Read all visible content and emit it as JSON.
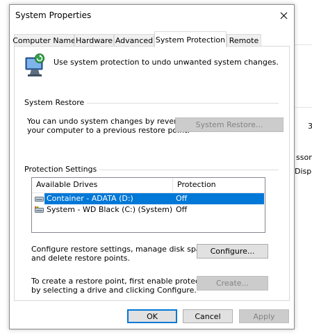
{
  "background": {
    "fragments": [
      "3",
      "ssor",
      "Displ"
    ]
  },
  "dialog": {
    "title": "System Properties",
    "tabs": [
      {
        "label": "Computer Name"
      },
      {
        "label": "Hardware"
      },
      {
        "label": "Advanced"
      },
      {
        "label": "System Protection"
      },
      {
        "label": "Remote"
      }
    ],
    "intro_text": "Use system protection to undo unwanted system changes.",
    "system_restore": {
      "group_label": "System Restore",
      "description_line1": "You can undo system changes by reverting",
      "description_line2": "your computer to a previous restore point.",
      "button_label": "System Restore..."
    },
    "protection_settings": {
      "group_label": "Protection Settings",
      "columns": [
        "Available Drives",
        "Protection"
      ],
      "drives": [
        {
          "name": "Container - ADATA (D:)",
          "protection": "Off",
          "selected": true
        },
        {
          "name": "System - WD Black (C:) (System)",
          "protection": "Off",
          "selected": false
        }
      ],
      "configure_text_line1": "Configure restore settings, manage disk space,",
      "configure_text_line2": "and delete restore points.",
      "configure_button": "Configure...",
      "create_text_line1": "To create a restore point, first enable protection",
      "create_text_line2": "by selecting a drive and clicking Configure.",
      "create_button": "Create..."
    },
    "footer": {
      "ok": "OK",
      "cancel": "Cancel",
      "apply": "Apply"
    }
  },
  "colors": {
    "accent": "#0078d7",
    "selection": "#0078d7",
    "disabled_button": "#cccccc"
  }
}
